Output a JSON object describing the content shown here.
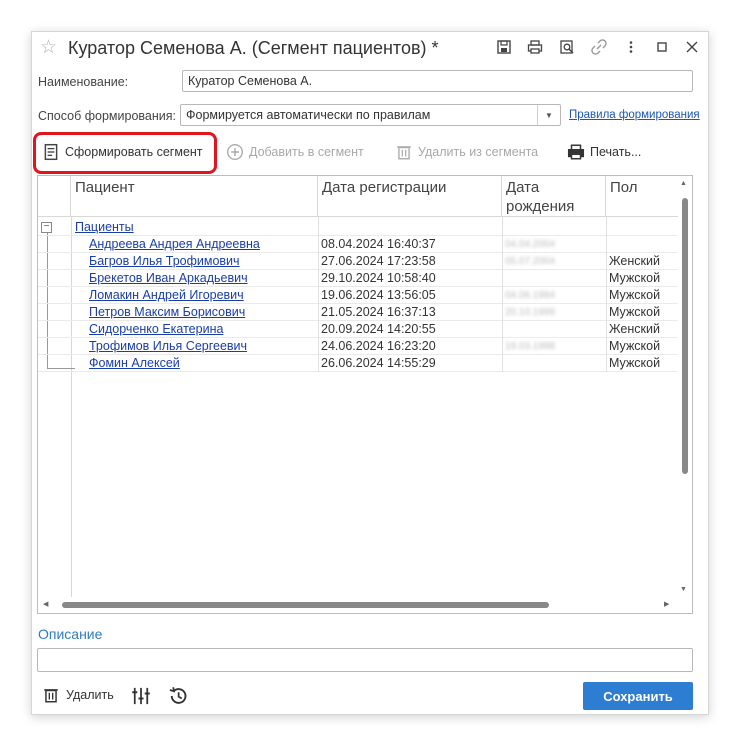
{
  "window": {
    "title": "Куратор Семенова А. (Сегмент пациентов) *"
  },
  "form": {
    "name_label": "Наименование:",
    "name_value": "Куратор Семенова А.",
    "method_label": "Способ формирования:",
    "method_value": "Формируется автоматически по правилам",
    "rules_link": "Правила формирования"
  },
  "toolbar": {
    "generate_label": "Сформировать сегмент",
    "add_label": "Добавить в сегмент",
    "remove_label": "Удалить из сегмента",
    "print_label": "Печать..."
  },
  "table": {
    "columns": [
      "Пациент",
      "Дата регистрации",
      "Дата\nрождения",
      "Пол"
    ],
    "group_label": "Пациенты",
    "rows": [
      {
        "name": "Андреева Андрея Андреевна",
        "reg": "08.04.2024 16:40:37",
        "birth": "04.04.2004",
        "sex": ""
      },
      {
        "name": "Багров Илья Трофимович",
        "reg": "27.06.2024 17:23:58",
        "birth": "05.07.2004",
        "sex": "Женский"
      },
      {
        "name": "Брекетов Иван Аркадьевич",
        "reg": "29.10.2024 10:58:40",
        "birth": "",
        "sex": "Мужской"
      },
      {
        "name": "Ломакин Андрей Игоревич",
        "reg": "19.06.2024 13:56:05",
        "birth": "04.06.1994",
        "sex": "Мужской"
      },
      {
        "name": "Петров Максим Борисович",
        "reg": "21.05.2024 16:37:13",
        "birth": "20.10.1999",
        "sex": "Мужской"
      },
      {
        "name": "Сидорченко Екатерина",
        "reg": "20.09.2024 14:20:55",
        "birth": "",
        "sex": "Женский"
      },
      {
        "name": "Трофимов Илья Сергеевич",
        "reg": "24.06.2024 16:23:20",
        "birth": "19.03.1998",
        "sex": "Мужской"
      },
      {
        "name": "Фомин Алексей",
        "reg": "26.06.2024 14:55:29",
        "birth": "",
        "sex": "Мужской"
      }
    ]
  },
  "description": {
    "label": "Описание",
    "value": ""
  },
  "bottom": {
    "delete_label": "Удалить",
    "save_label": "Сохранить"
  },
  "colors": {
    "accent": "#2d7dd2",
    "highlight": "#e0151e",
    "link": "#1a3ea8"
  }
}
